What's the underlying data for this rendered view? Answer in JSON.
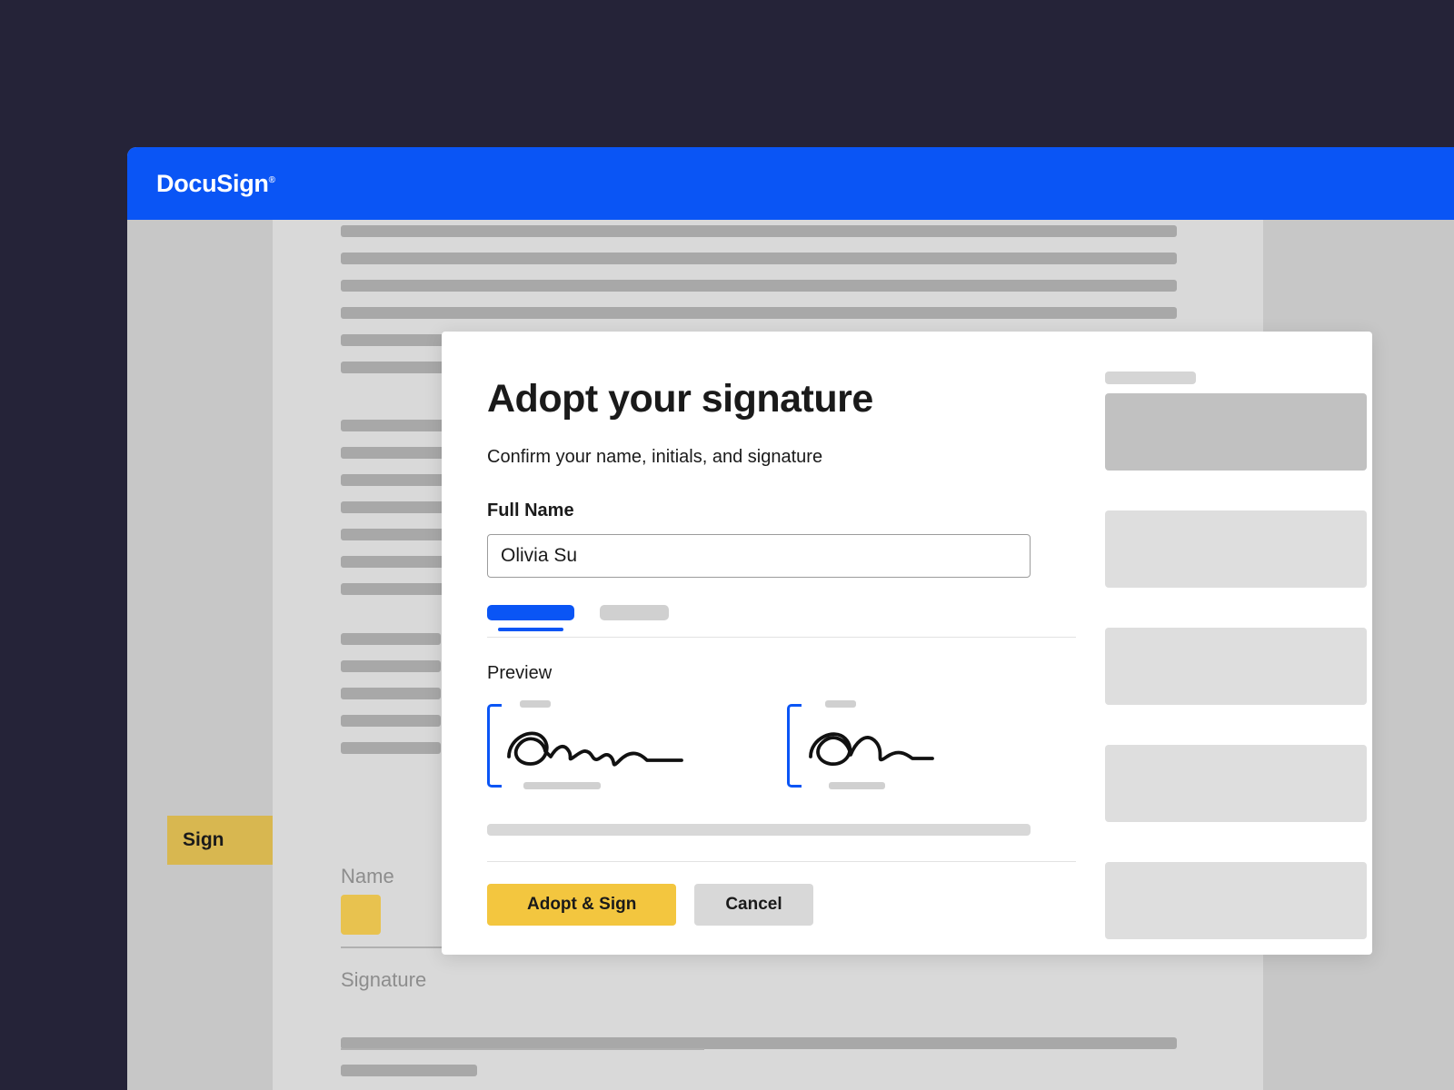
{
  "brand": "DocuSign",
  "sign_tab_label": "Sign",
  "doc_fields": {
    "name_label": "Name",
    "signature_label": "Signature"
  },
  "modal": {
    "title": "Adopt your signature",
    "subtitle": "Confirm your name, initials, and signature",
    "full_name_label": "Full Name",
    "full_name_value": "Olivia Su",
    "preview_label": "Preview",
    "adopt_button": "Adopt & Sign",
    "cancel_button": "Cancel"
  },
  "colors": {
    "brand_blue": "#0a55f5",
    "accent_yellow": "#f3c63f",
    "tab_yellow": "#d8b750",
    "bg_dark": "#252338"
  }
}
